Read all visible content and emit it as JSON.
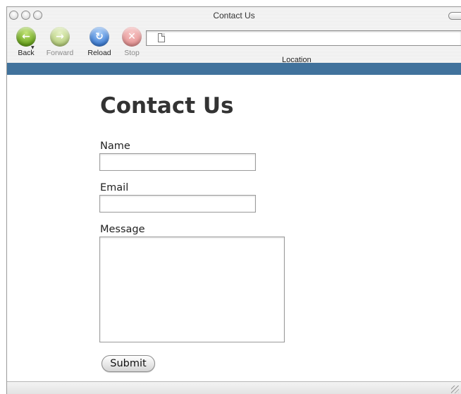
{
  "window": {
    "title": "Contact Us"
  },
  "toolbar": {
    "back_label": "Back",
    "forward_label": "Forward",
    "reload_label": "Reload",
    "stop_label": "Stop",
    "location_label": "Location",
    "location_value": "",
    "icons": {
      "back": "back-arrow-icon",
      "forward": "forward-arrow-icon",
      "reload": "reload-icon",
      "stop": "stop-x-icon",
      "page": "page-document-icon"
    }
  },
  "colors": {
    "accent_bar": "#41729c",
    "back_green": "#6aa51d",
    "reload_blue": "#3f7fd6",
    "stop_red": "#e79595"
  },
  "form": {
    "title": "Contact Us",
    "name_label": "Name",
    "name_value": "",
    "email_label": "Email",
    "email_value": "",
    "message_label": "Message",
    "message_value": "",
    "submit_label": "Submit"
  }
}
